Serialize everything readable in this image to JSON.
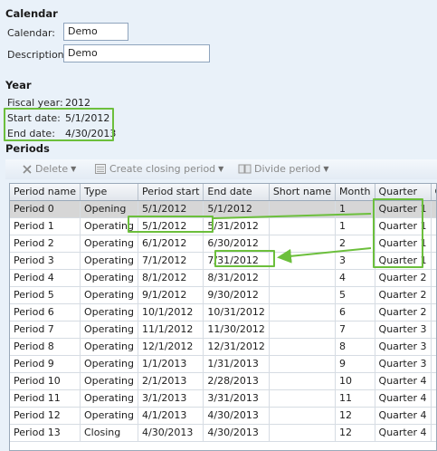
{
  "calendar": {
    "heading": "Calendar",
    "calendar_label": "Calendar:",
    "calendar_value": "Demo",
    "description_label": "Description:",
    "description_value": "Demo"
  },
  "year": {
    "heading": "Year",
    "fiscal_year_label": "Fiscal year:",
    "fiscal_year_value": "2012",
    "start_date_label": "Start date:",
    "start_date_value": "5/1/2012",
    "end_date_label": "End date:",
    "end_date_value": "4/30/2013"
  },
  "periods": {
    "heading": "Periods",
    "toolbar": {
      "delete_label": "Delete",
      "create_closing_label": "Create closing period",
      "divide_label": "Divide period"
    },
    "columns": [
      "Period name",
      "Type",
      "Period start",
      "End date",
      "Short name",
      "Month",
      "Quarter",
      "C"
    ],
    "rows": [
      [
        "Period 0",
        "Opening",
        "5/1/2012",
        "5/1/2012",
        "",
        "1",
        "Quarter 1"
      ],
      [
        "Period 1",
        "Operating",
        "5/1/2012",
        "5/31/2012",
        "",
        "1",
        "Quarter 1"
      ],
      [
        "Period 2",
        "Operating",
        "6/1/2012",
        "6/30/2012",
        "",
        "2",
        "Quarter 1"
      ],
      [
        "Period 3",
        "Operating",
        "7/1/2012",
        "7/31/2012",
        "",
        "3",
        "Quarter 1"
      ],
      [
        "Period 4",
        "Operating",
        "8/1/2012",
        "8/31/2012",
        "",
        "4",
        "Quarter 2"
      ],
      [
        "Period 5",
        "Operating",
        "9/1/2012",
        "9/30/2012",
        "",
        "5",
        "Quarter 2"
      ],
      [
        "Period 6",
        "Operating",
        "10/1/2012",
        "10/31/2012",
        "",
        "6",
        "Quarter 2"
      ],
      [
        "Period 7",
        "Operating",
        "11/1/2012",
        "11/30/2012",
        "",
        "7",
        "Quarter 3"
      ],
      [
        "Period 8",
        "Operating",
        "12/1/2012",
        "12/31/2012",
        "",
        "8",
        "Quarter 3"
      ],
      [
        "Period 9",
        "Operating",
        "1/1/2013",
        "1/31/2013",
        "",
        "9",
        "Quarter 3"
      ],
      [
        "Period 10",
        "Operating",
        "2/1/2013",
        "2/28/2013",
        "",
        "10",
        "Quarter 4"
      ],
      [
        "Period 11",
        "Operating",
        "3/1/2013",
        "3/31/2013",
        "",
        "11",
        "Quarter 4"
      ],
      [
        "Period 12",
        "Operating",
        "4/1/2013",
        "4/30/2013",
        "",
        "12",
        "Quarter 4"
      ],
      [
        "Period 13",
        "Closing",
        "4/30/2013",
        "4/30/2013",
        "",
        "12",
        "Quarter 4"
      ]
    ]
  },
  "colors": {
    "highlight": "#6cbf3c",
    "selected_row": "#d6d6d6",
    "background": "#e9f1f9"
  },
  "icons": {
    "delete": "x-icon",
    "create_closing": "document-icon",
    "divide": "divide-icon"
  }
}
